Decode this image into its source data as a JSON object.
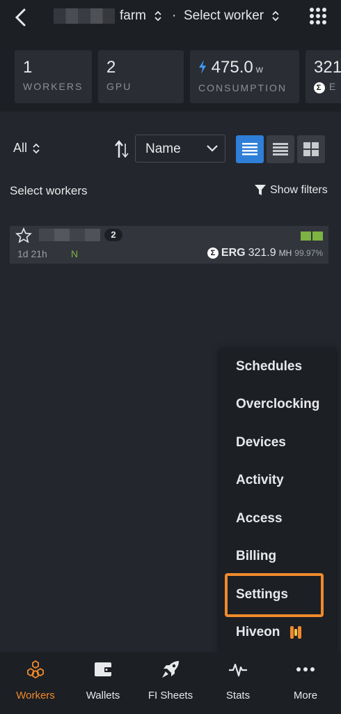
{
  "header": {
    "farm_label": "farm",
    "separator": "·",
    "worker_select_label": "Select worker"
  },
  "stats": [
    {
      "value": "1",
      "label": "WORKERS"
    },
    {
      "value": "2",
      "label": "GPU"
    },
    {
      "value": "475.0",
      "unit": "w",
      "label": "CONSUMPTION"
    },
    {
      "value": "321",
      "label": "E"
    }
  ],
  "filters": {
    "group_label": "All",
    "sort_value": "Name"
  },
  "list": {
    "heading": "Select workers",
    "show_filters_label": "Show filters"
  },
  "worker": {
    "gpu_count": "2",
    "uptime": "1d 21h",
    "flag": "N",
    "coin": "ERG",
    "hashrate": "321.9",
    "hash_unit": "MH",
    "efficiency": "99.97%"
  },
  "menu": {
    "items": [
      "Schedules",
      "Overclocking",
      "Devices",
      "Activity",
      "Access",
      "Billing",
      "Settings",
      "Hiveon"
    ],
    "highlighted": "Settings"
  },
  "bottom_nav": [
    {
      "label": "Workers",
      "icon": "hive-icon",
      "active": true
    },
    {
      "label": "Wallets",
      "icon": "wallet-icon",
      "active": false
    },
    {
      "label": "FI Sheets",
      "icon": "rocket-icon",
      "active": false
    },
    {
      "label": "Stats",
      "icon": "pulse-icon",
      "active": false
    },
    {
      "label": "More",
      "icon": "more-dots-icon",
      "active": false
    }
  ],
  "colors": {
    "accent": "#f08a2c",
    "active_view": "#2f7fd8",
    "gpu_ok": "#7cb342",
    "lightning": "#3d9bf0"
  }
}
